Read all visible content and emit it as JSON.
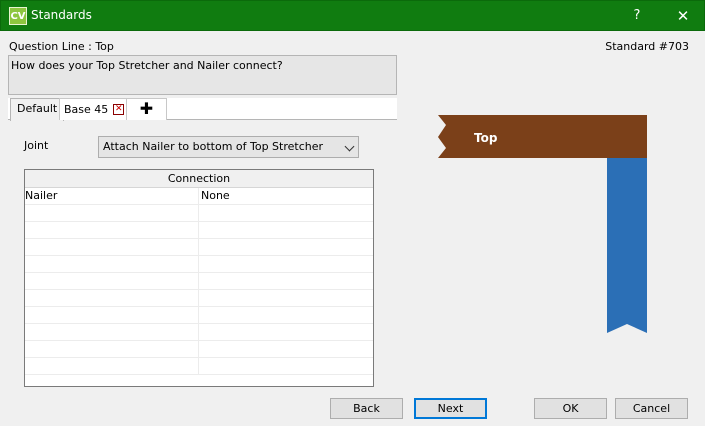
{
  "window": {
    "app_logo": "CV",
    "title": "Standards",
    "help_label": "?",
    "close_label": "✕"
  },
  "header": {
    "question_line_label": "Question Line : Top",
    "standard_label": "Standard #703"
  },
  "question": {
    "text": "How does your Top Stretcher and Nailer connect?"
  },
  "tabs": [
    {
      "label": "Default"
    },
    {
      "label": "Base 45"
    }
  ],
  "tab_add_label": "✚",
  "joint": {
    "label": "Joint",
    "selected": "Attach Nailer to bottom of Top Stretcher"
  },
  "connection_grid": {
    "header": "Connection",
    "rows": [
      [
        "Nailer",
        "None"
      ]
    ]
  },
  "diagram": {
    "top_label": "Top",
    "top_color": "#7b4019",
    "nailer_color": "#2b6fb6"
  },
  "buttons": {
    "back": "Back",
    "next": "Next",
    "ok": "OK",
    "cancel": "Cancel"
  },
  "colors": {
    "titlebar": "#107c10",
    "focus": "#0078d7"
  }
}
